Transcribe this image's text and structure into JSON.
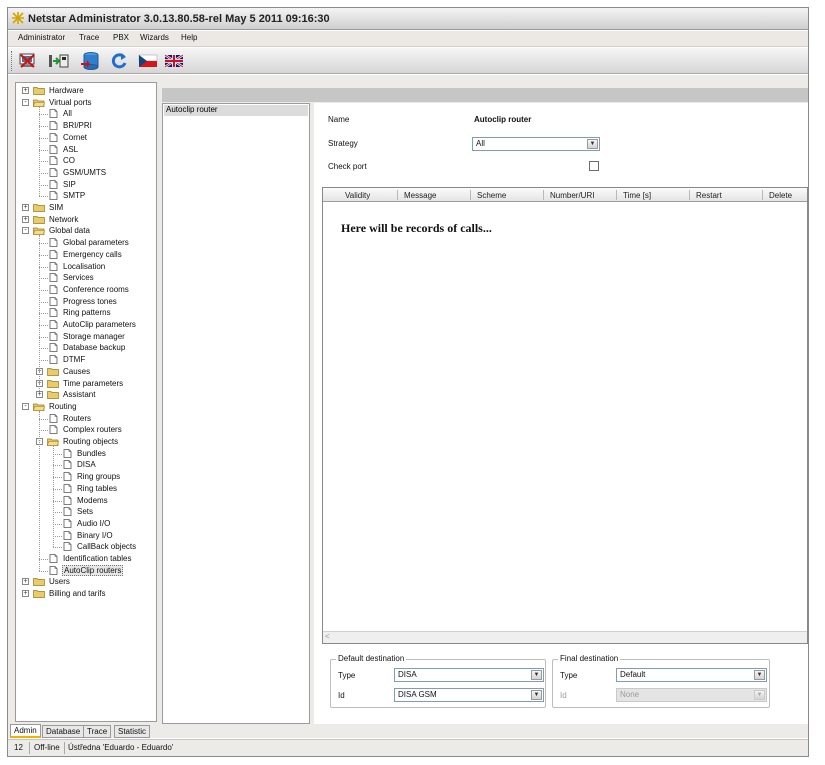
{
  "window": {
    "title": "Netstar Administrator 3.0.13.80.58-rel May  5 2011 09:16:30"
  },
  "menu": [
    "Administrator",
    "Trace",
    "PBX",
    "Wizards",
    "Help"
  ],
  "toolbar": [
    "exit-icon",
    "connect-icon",
    "database-icon",
    "refresh-icon",
    "czech-flag-icon",
    "uk-flag-icon"
  ],
  "tree": [
    {
      "label": "Hardware",
      "level": 0,
      "expander": "+",
      "icon": "folder"
    },
    {
      "label": "Virtual ports",
      "level": 0,
      "expander": "-",
      "icon": "folder-open"
    },
    {
      "label": "All",
      "level": 1,
      "icon": "doc"
    },
    {
      "label": "BRI/PRI",
      "level": 1,
      "icon": "doc"
    },
    {
      "label": "Cornet",
      "level": 1,
      "icon": "doc"
    },
    {
      "label": "ASL",
      "level": 1,
      "icon": "doc"
    },
    {
      "label": "CO",
      "level": 1,
      "icon": "doc"
    },
    {
      "label": "GSM/UMTS",
      "level": 1,
      "icon": "doc"
    },
    {
      "label": "SIP",
      "level": 1,
      "icon": "doc"
    },
    {
      "label": "SMTP",
      "level": 1,
      "icon": "doc"
    },
    {
      "label": "SIM",
      "level": 0,
      "expander": "+",
      "icon": "folder"
    },
    {
      "label": "Network",
      "level": 0,
      "expander": "+",
      "icon": "folder"
    },
    {
      "label": "Global data",
      "level": 0,
      "expander": "-",
      "icon": "folder-open"
    },
    {
      "label": "Global parameters",
      "level": 1,
      "icon": "doc"
    },
    {
      "label": "Emergency calls",
      "level": 1,
      "icon": "doc"
    },
    {
      "label": "Localisation",
      "level": 1,
      "icon": "doc"
    },
    {
      "label": "Services",
      "level": 1,
      "icon": "doc"
    },
    {
      "label": "Conference rooms",
      "level": 1,
      "icon": "doc"
    },
    {
      "label": "Progress tones",
      "level": 1,
      "icon": "doc"
    },
    {
      "label": "Ring patterns",
      "level": 1,
      "icon": "doc"
    },
    {
      "label": "AutoClip parameters",
      "level": 1,
      "icon": "doc"
    },
    {
      "label": "Storage manager",
      "level": 1,
      "icon": "doc"
    },
    {
      "label": "Database backup",
      "level": 1,
      "icon": "doc"
    },
    {
      "label": "DTMF",
      "level": 1,
      "icon": "doc"
    },
    {
      "label": "Causes",
      "level": 1,
      "expander": "+",
      "icon": "folder"
    },
    {
      "label": "Time parameters",
      "level": 1,
      "expander": "+",
      "icon": "folder"
    },
    {
      "label": "Assistant",
      "level": 1,
      "expander": "+",
      "icon": "folder"
    },
    {
      "label": "Routing",
      "level": 0,
      "expander": "-",
      "icon": "folder-open"
    },
    {
      "label": "Routers",
      "level": 1,
      "icon": "doc"
    },
    {
      "label": "Complex routers",
      "level": 1,
      "icon": "doc"
    },
    {
      "label": "Routing objects",
      "level": 1,
      "expander": "-",
      "icon": "folder-open"
    },
    {
      "label": "Bundles",
      "level": 2,
      "icon": "doc"
    },
    {
      "label": "DISA",
      "level": 2,
      "icon": "doc"
    },
    {
      "label": "Ring groups",
      "level": 2,
      "icon": "doc"
    },
    {
      "label": "Ring tables",
      "level": 2,
      "icon": "doc"
    },
    {
      "label": "Modems",
      "level": 2,
      "icon": "doc"
    },
    {
      "label": "Sets",
      "level": 2,
      "icon": "doc"
    },
    {
      "label": "Audio I/O",
      "level": 2,
      "icon": "doc"
    },
    {
      "label": "Binary I/O",
      "level": 2,
      "icon": "doc"
    },
    {
      "label": "CallBack objects",
      "level": 2,
      "icon": "doc"
    },
    {
      "label": "Identification tables",
      "level": 1,
      "icon": "doc"
    },
    {
      "label": "AutoClip routers",
      "level": 1,
      "icon": "doc",
      "selected": true
    },
    {
      "label": "Users",
      "level": 0,
      "expander": "+",
      "icon": "folder"
    },
    {
      "label": "Billing and tarifs",
      "level": 0,
      "expander": "+",
      "icon": "folder"
    }
  ],
  "list": {
    "items": [
      "Autoclip router"
    ]
  },
  "detail": {
    "name_label": "Name",
    "name_value": "Autoclip router",
    "strategy_label": "Strategy",
    "strategy_value": "All",
    "checkport_label": "Check port",
    "checkport_checked": false,
    "grid_columns": [
      "Validity",
      "Message",
      "Scheme",
      "Number/URI",
      "Time [s]",
      "Restart",
      "Delete"
    ],
    "grid_message": "Here will be records of calls...",
    "grid_scroll_glyph": "<"
  },
  "default_destination": {
    "caption": "Default destination",
    "type_label": "Type",
    "type_value": "DISA",
    "id_label": "Id",
    "id_value": "DISA GSM"
  },
  "final_destination": {
    "caption": "Final destination",
    "type_label": "Type",
    "type_value": "Default",
    "id_label": "Id",
    "id_value": "None"
  },
  "tabs": {
    "items": [
      "Admin",
      "Database",
      "Trace",
      "Statistic"
    ],
    "active": "Admin"
  },
  "status": {
    "count": "12",
    "state": "Off-line",
    "pbx": "Ústředna 'Eduardo - Eduardo'"
  }
}
